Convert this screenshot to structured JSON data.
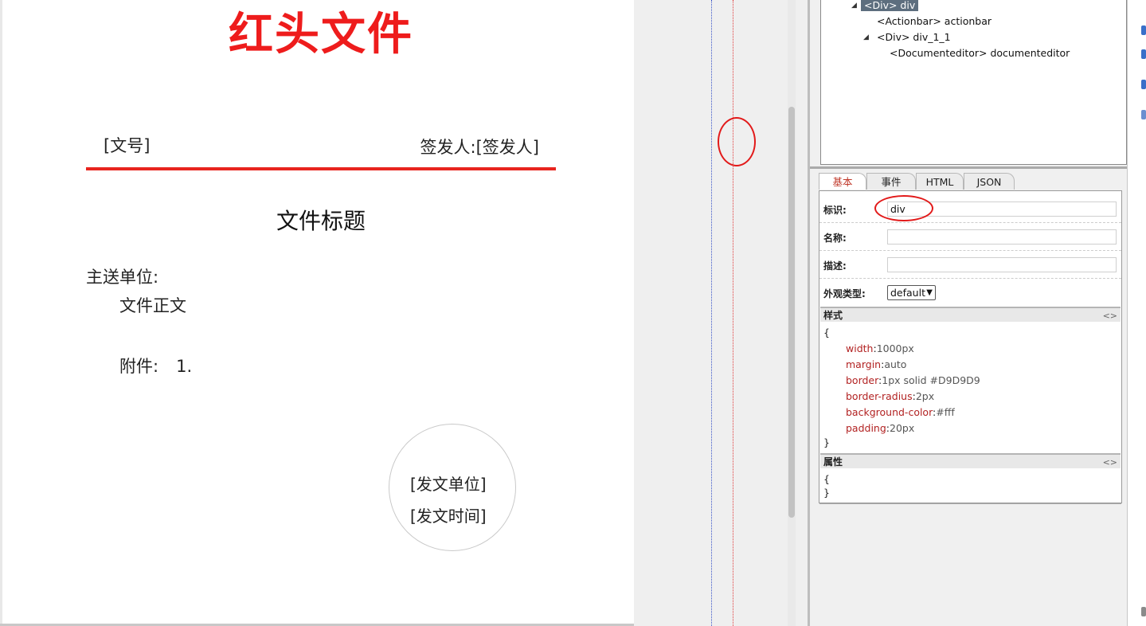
{
  "document": {
    "title": "红头文件",
    "doc_number": "[文号]",
    "signer_label": "签发人:",
    "signer_value": "[签发人]",
    "subject": "文件标题",
    "recipient_label": "主送单位:",
    "body": "文件正文",
    "attachment_label": "附件:",
    "attachment_number": "1.",
    "issuer": "[发文单位]",
    "issue_date": "[发文时间]",
    "colors": {
      "title": "#ee1c1c",
      "rule": "#e8241e"
    }
  },
  "tree": {
    "root": "<Div> div",
    "items": [
      {
        "label": "<Actionbar> actionbar"
      },
      {
        "label": "<Div> div_1_1"
      },
      {
        "label": "<Documenteditor> documenteditor"
      }
    ]
  },
  "tabs": [
    {
      "label": "基本",
      "active": true
    },
    {
      "label": "事件"
    },
    {
      "label": "HTML"
    },
    {
      "label": "JSON"
    }
  ],
  "form": {
    "id_label": "标识:",
    "id_value": "div",
    "name_label": "名称:",
    "name_value": "",
    "desc_label": "描述:",
    "desc_value": "",
    "appearance_label": "外观类型:",
    "appearance_value": "default"
  },
  "style_section": {
    "title": "样式",
    "toggle": "<>",
    "open": "{",
    "close": "}",
    "rules": [
      {
        "key": "width",
        "value": "1000px"
      },
      {
        "key": "margin",
        "value": "auto"
      },
      {
        "key": "border",
        "value": "1px solid #D9D9D9"
      },
      {
        "key": "border-radius",
        "value": "2px"
      },
      {
        "key": "background-color",
        "value": "#fff"
      },
      {
        "key": "padding",
        "value": "20px"
      }
    ]
  },
  "attr_section": {
    "title": "属性",
    "toggle": "<>",
    "open": "{",
    "close": "}"
  }
}
